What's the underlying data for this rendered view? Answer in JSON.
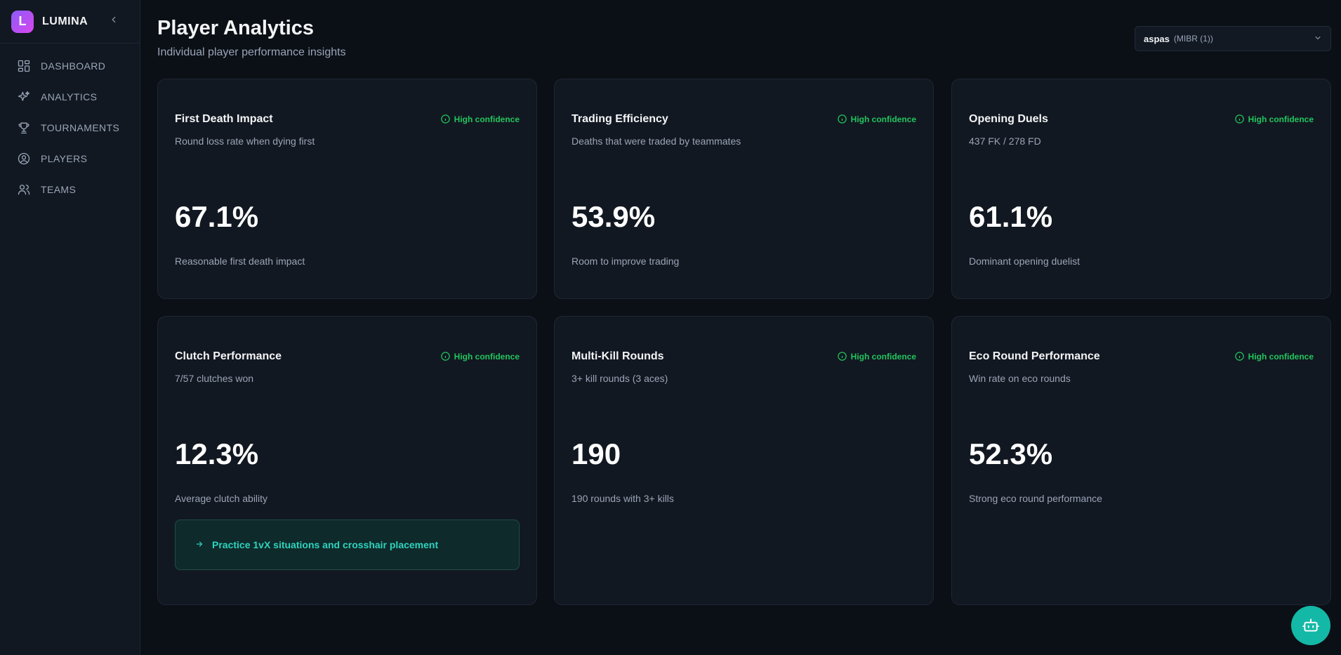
{
  "brand": {
    "logo_letter": "L",
    "name": "LUMINA",
    "collapse_icon": "chevron-left-icon"
  },
  "nav": [
    {
      "label": "DASHBOARD",
      "icon": "dashboard-grid-icon"
    },
    {
      "label": "ANALYTICS",
      "icon": "sparkles-icon"
    },
    {
      "label": "TOURNAMENTS",
      "icon": "trophy-icon"
    },
    {
      "label": "PLAYERS",
      "icon": "user-circle-icon"
    },
    {
      "label": "TEAMS",
      "icon": "users-icon"
    }
  ],
  "header": {
    "title": "Player Analytics",
    "subtitle": "Individual player performance insights",
    "player_select": {
      "name": "aspas",
      "team": "(MIBR (1))"
    }
  },
  "cards": [
    {
      "title": "First Death Impact",
      "desc": "Round loss rate when dying first",
      "confidence": "High confidence",
      "value": "67.1%",
      "note": "Reasonable first death impact"
    },
    {
      "title": "Trading Efficiency",
      "desc": "Deaths that were traded by teammates",
      "confidence": "High confidence",
      "value": "53.9%",
      "note": "Room to improve trading"
    },
    {
      "title": "Opening Duels",
      "desc": "437 FK / 278 FD",
      "confidence": "High confidence",
      "value": "61.1%",
      "note": "Dominant opening duelist"
    },
    {
      "title": "Clutch Performance",
      "desc": "7/57 clutches won",
      "confidence": "High confidence",
      "value": "12.3%",
      "note": "Average clutch ability",
      "tip": "Practice 1vX situations and crosshair placement"
    },
    {
      "title": "Multi-Kill Rounds",
      "desc": "3+ kill rounds (3 aces)",
      "confidence": "High confidence",
      "value": "190",
      "note": "190 rounds with 3+ kills"
    },
    {
      "title": "Eco Round Performance",
      "desc": "Win rate on eco rounds",
      "confidence": "High confidence",
      "value": "52.3%",
      "note": "Strong eco round performance"
    }
  ],
  "colors": {
    "accent": "#14b8a6",
    "confidence": "#22c55e",
    "background": "#0b0f16",
    "card": "#121821"
  }
}
